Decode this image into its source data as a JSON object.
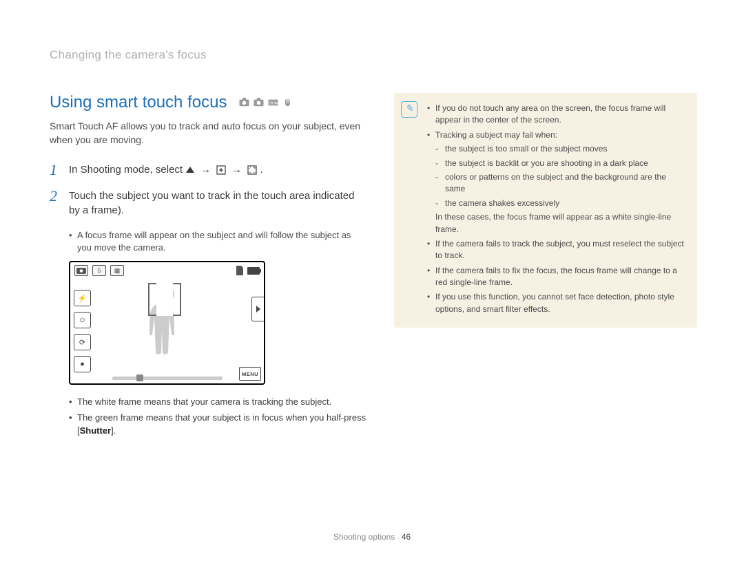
{
  "breadcrumb": "Changing the camera's focus",
  "heading": "Using smart touch focus",
  "intro": "Smart Touch AF allows you to track and auto focus on your subject, even when you are moving.",
  "steps": {
    "1": {
      "num": "1",
      "text_before": "In Shooting mode, select ",
      "sep1": " → ",
      "sep2": " → ",
      "text_after_end": "."
    },
    "2": {
      "num": "2",
      "text": "Touch the subject you want to track in the touch area indicated by a frame)."
    }
  },
  "inner_bullets": [
    "A focus frame will appear on the subject and will follow the subject as you move the camera."
  ],
  "camera_screen": {
    "menu_label": "MENU",
    "badge_text": "5"
  },
  "lower_bullets": [
    "The white frame means that your camera is tracking the subject.",
    "The green frame means that your subject is in focus when you half-press [Shutter]."
  ],
  "note": {
    "items": [
      "If you do not touch any area on the screen, the focus frame will appear in the center of the screen.",
      "Tracking a subject may fail when:"
    ],
    "subitems": [
      "the subject is too small or the subject moves",
      "the subject is backlit or you are shooting in a dark place",
      "colors or patterns on the subject and the background are the same",
      "the camera shakes excessively"
    ],
    "after_sub": "In these cases, the focus frame will appear as a white single-line frame.",
    "more": [
      "If the camera fails to track the subject, you must reselect the subject to track.",
      "If the camera fails to fix the focus, the focus frame will change to a red single-line frame.",
      "If you use this function, you cannot set face detection, photo style options, and smart filter effects."
    ]
  },
  "footer": {
    "section": "Shooting options",
    "page": "46"
  },
  "shutter_word": "Shutter"
}
